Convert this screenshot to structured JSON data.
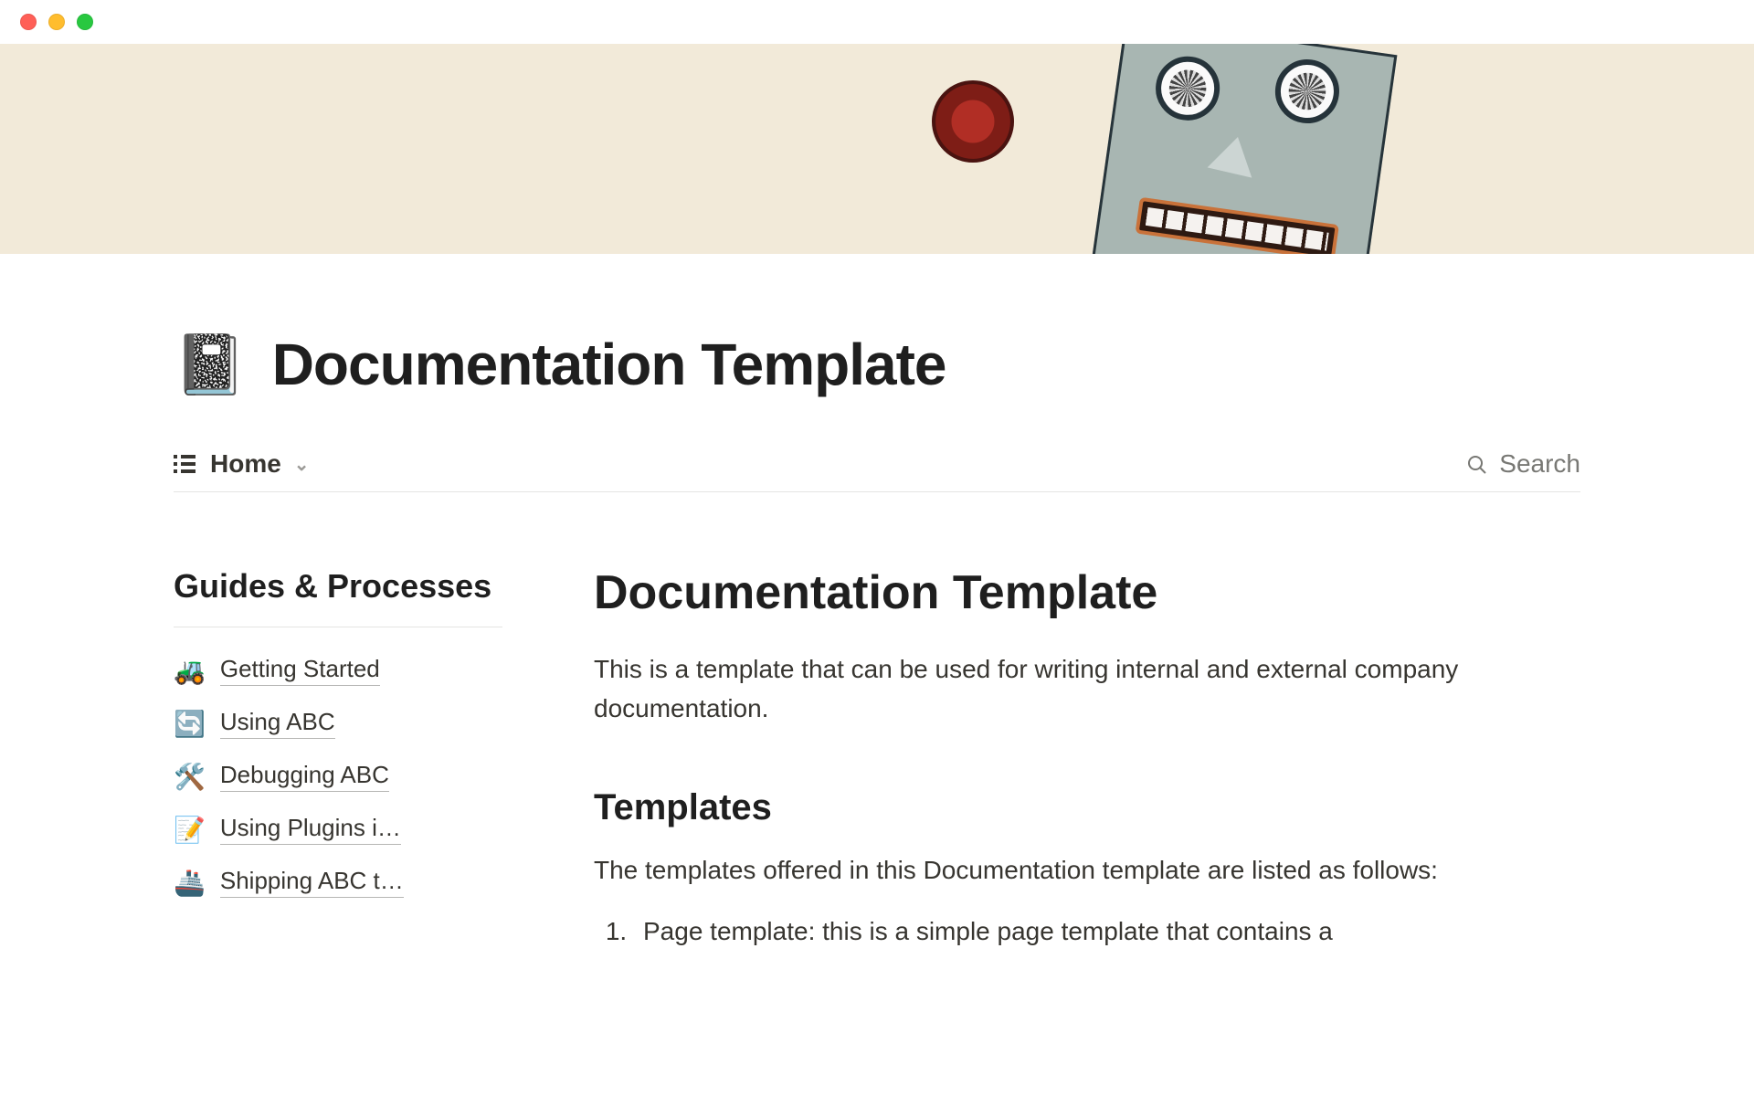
{
  "page": {
    "icon": "📓",
    "title": "Documentation Template"
  },
  "viewbar": {
    "view_name": "Home",
    "search_label": "Search"
  },
  "sidebar": {
    "heading": "Guides & Processes",
    "items": [
      {
        "emoji": "🚜",
        "label": "Getting Started"
      },
      {
        "emoji": "🔄",
        "label": "Using ABC"
      },
      {
        "emoji": "🛠️",
        "label": "Debugging ABC"
      },
      {
        "emoji": "📝",
        "label": "Using Plugins i…"
      },
      {
        "emoji": "🚢",
        "label": "Shipping ABC t…"
      }
    ]
  },
  "content": {
    "heading": "Documentation Template",
    "lead": "This is a template that can be used for writing internal and external company documentation.",
    "section_heading": "Templates",
    "section_body": "The templates offered in this Documentation template are listed as follows:",
    "list": [
      "Page template: this is a simple page template that contains a"
    ]
  }
}
